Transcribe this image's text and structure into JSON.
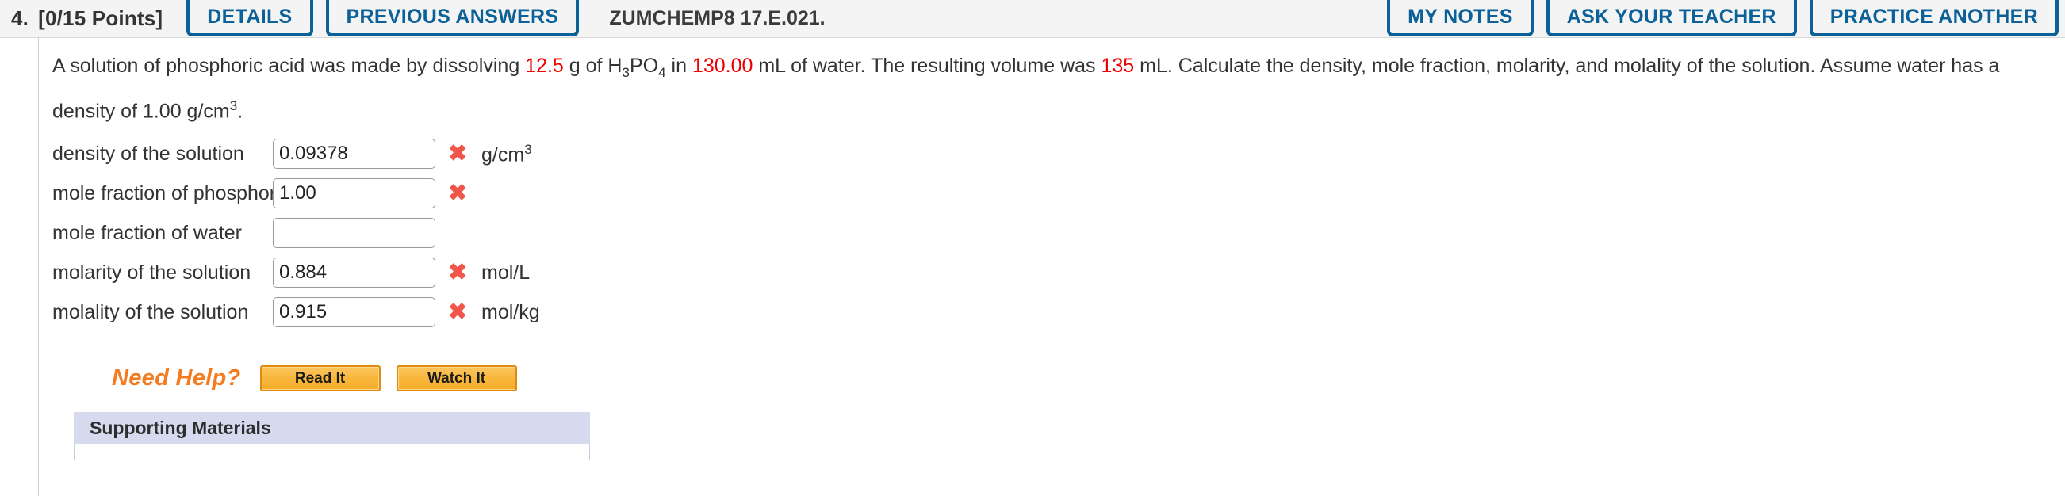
{
  "header": {
    "question_number": "4.",
    "points": "[0/15 Points]",
    "buttons_left": [
      {
        "label": "DETAILS",
        "name": "details-button"
      },
      {
        "label": "PREVIOUS ANSWERS",
        "name": "previous-answers-button"
      }
    ],
    "assignment_title": "ZUMCHEMP8 17.E.021.",
    "buttons_right": [
      {
        "label": "MY NOTES",
        "name": "my-notes-button"
      },
      {
        "label": "ASK YOUR TEACHER",
        "name": "ask-your-teacher-button"
      },
      {
        "label": "PRACTICE ANOTHER",
        "name": "practice-another-button"
      }
    ],
    "accent_color": "#0b6198",
    "title_color": "#3b3b3b"
  },
  "question": {
    "line1_part1": "A solution of phosphoric acid was made by dissolving ",
    "value_mass": "12.5",
    "line1_part2": " g of H",
    "formula_sub1": "3",
    "formula_mid": "PO",
    "formula_sub2": "4",
    "line1_part3": " in ",
    "value_volume_water": "130.00",
    "line1_part4": " mL of water. The resulting volume was ",
    "value_volume_total": "135",
    "line1_part5": " mL. Calculate the density, mole fraction, molarity, and molality of the solution. Assume water has a density of 1.00 g/cm",
    "density_sup": "3",
    "line1_end": ".",
    "highlight_color": "#ee0000"
  },
  "answers": [
    {
      "label": "density of the solution",
      "value": "0.09378",
      "unit": "g/cm",
      "unit_sup": "3",
      "status": "incorrect"
    },
    {
      "label": "mole fraction of phosphoric acid",
      "value": "1.00",
      "unit": "",
      "unit_sup": "",
      "status": "incorrect"
    },
    {
      "label": "mole fraction of water",
      "value": "",
      "unit": "",
      "unit_sup": "",
      "status": "none"
    },
    {
      "label": "molarity of the solution",
      "value": "0.884",
      "unit": "mol/L",
      "unit_sup": "",
      "status": "incorrect"
    },
    {
      "label": "molality of the solution",
      "value": "0.915",
      "unit": "mol/kg",
      "unit_sup": "",
      "status": "incorrect"
    }
  ],
  "incorrect_mark": "✖",
  "incorrect_color": "#f0564a",
  "need_help": {
    "label": "Need Help?",
    "label_color": "#f47b20",
    "buttons": [
      {
        "label": "Read It",
        "name": "read-it-button"
      },
      {
        "label": "Watch It",
        "name": "watch-it-button"
      }
    ]
  },
  "supporting_materials": {
    "title": "Supporting Materials",
    "header_bg": "#d5daef"
  }
}
